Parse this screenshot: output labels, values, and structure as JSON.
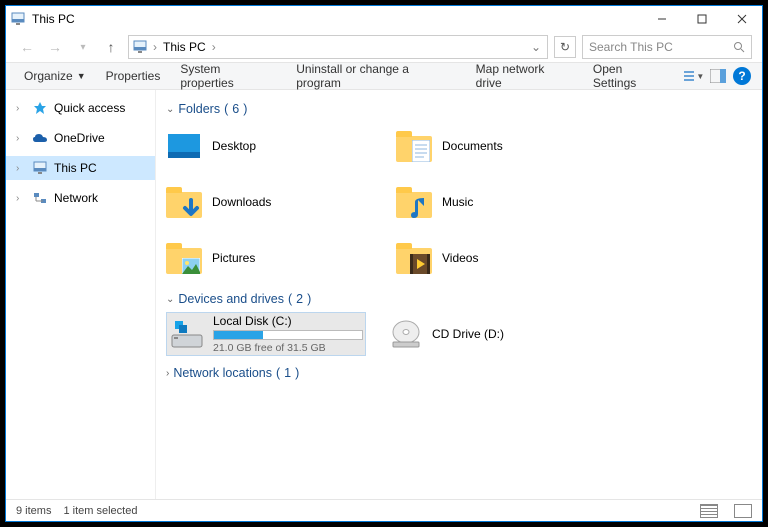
{
  "title": "This PC",
  "nav": {
    "back_enabled": false,
    "forward_enabled": false
  },
  "address": {
    "root": "This PC"
  },
  "search": {
    "placeholder": "Search This PC"
  },
  "toolbar": {
    "organize": "Organize",
    "properties": "Properties",
    "system_properties": "System properties",
    "uninstall": "Uninstall or change a program",
    "map_drive": "Map network drive",
    "open_settings": "Open Settings"
  },
  "sidebar": {
    "items": [
      {
        "label": "Quick access",
        "icon": "star",
        "color": "#2aa3e6"
      },
      {
        "label": "OneDrive",
        "icon": "cloud",
        "color": "#1b5faa"
      },
      {
        "label": "This PC",
        "icon": "monitor",
        "color": "#2aa3e6",
        "selected": true
      },
      {
        "label": "Network",
        "icon": "network",
        "color": "#2aa3e6"
      }
    ]
  },
  "groups": {
    "folders": {
      "label": "Folders",
      "count": 6
    },
    "drives": {
      "label": "Devices and drives",
      "count": 2
    },
    "netloc": {
      "label": "Network locations",
      "count": 1
    }
  },
  "folders": [
    {
      "label": "Desktop",
      "overlay": "desktop"
    },
    {
      "label": "Documents",
      "overlay": "doc"
    },
    {
      "label": "Downloads",
      "overlay": "down"
    },
    {
      "label": "Music",
      "overlay": "music"
    },
    {
      "label": "Pictures",
      "overlay": "pic"
    },
    {
      "label": "Videos",
      "overlay": "video"
    }
  ],
  "drives": [
    {
      "label": "Local Disk (C:)",
      "free_text": "21.0 GB free of 31.5 GB",
      "used_pct": 33,
      "icon": "hdd",
      "selected": true
    },
    {
      "label": "CD Drive (D:)",
      "icon": "cd"
    }
  ],
  "status": {
    "items": "9 items",
    "selected": "1 item selected"
  }
}
